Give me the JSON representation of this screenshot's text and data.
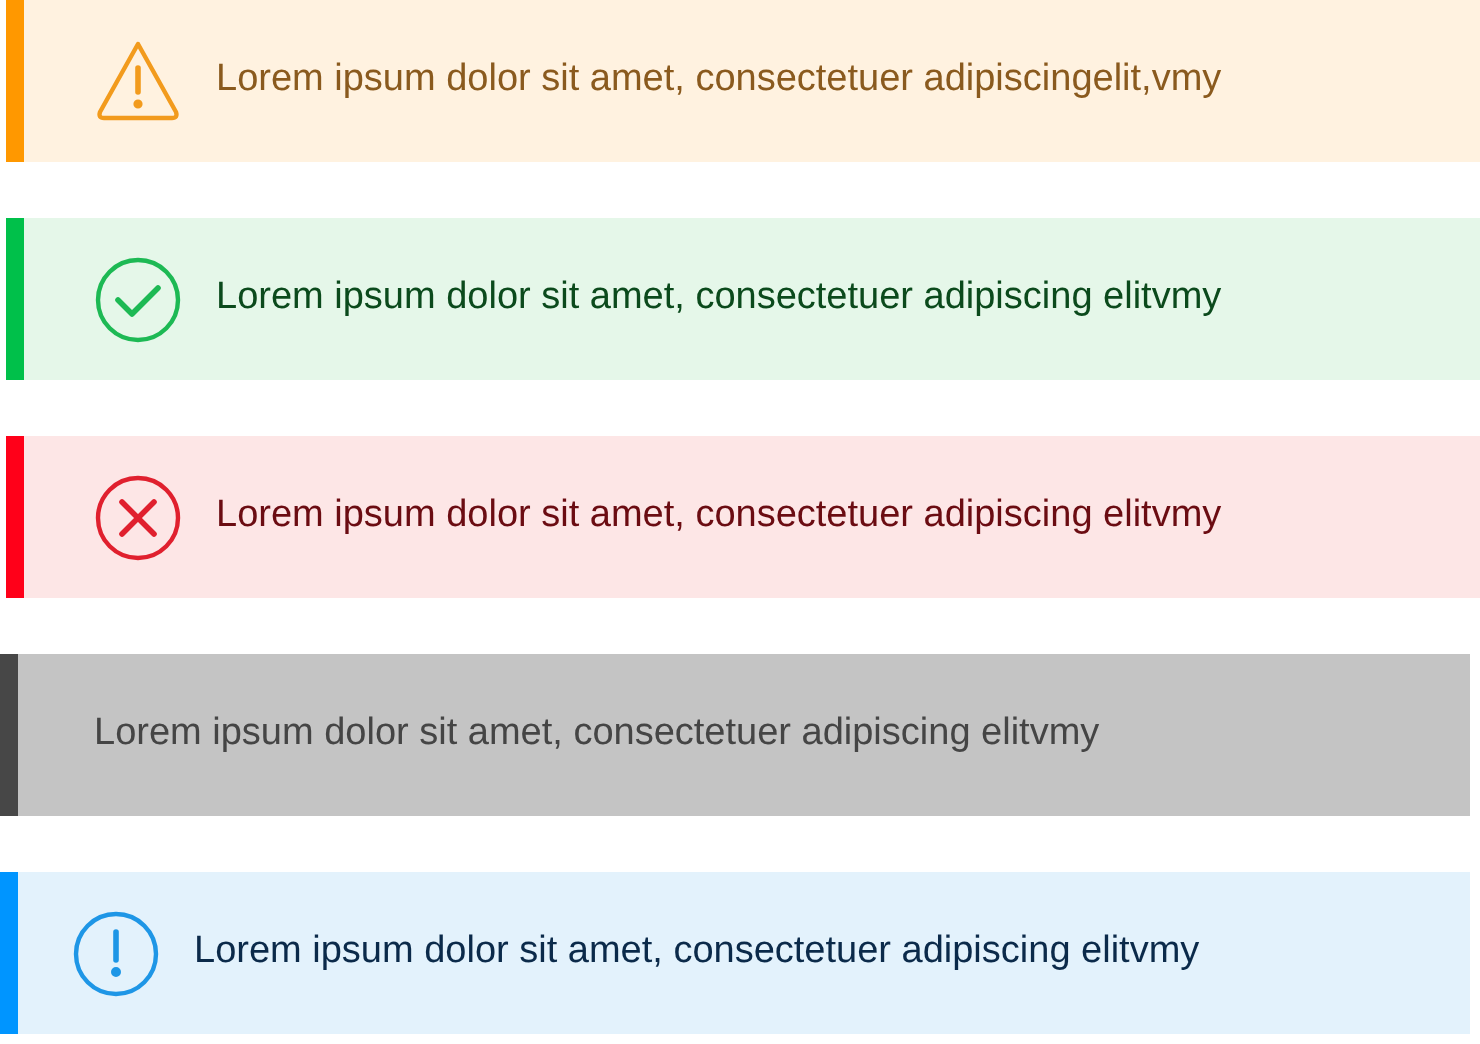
{
  "alerts": [
    {
      "kind": "warning",
      "message": "Lorem ipsum dolor sit amet, consectetuer adipiscingelit,vmy"
    },
    {
      "kind": "success",
      "message": "Lorem ipsum dolor sit amet, consectetuer adipiscing elitvmy"
    },
    {
      "kind": "error",
      "message": "Lorem ipsum dolor sit amet, consectetuer adipiscing elitvmy"
    },
    {
      "kind": "neutral",
      "message": "Lorem ipsum dolor sit amet, consectetuer adipiscing elitvmy"
    },
    {
      "kind": "info",
      "message": "Lorem ipsum dolor sit amet, consectetuer adipiscing elitvmy"
    }
  ]
}
